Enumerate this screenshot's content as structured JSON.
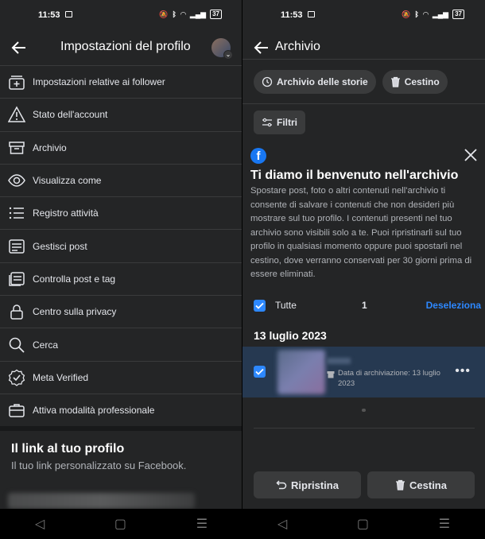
{
  "left": {
    "status": {
      "time": "11:53",
      "battery": "37"
    },
    "header": {
      "title": "Impostazioni del profilo"
    },
    "menu": [
      {
        "label": "Impostazioni relative ai follower",
        "icon": "follower-add-icon"
      },
      {
        "label": "Stato dell'account",
        "icon": "warning-icon"
      },
      {
        "label": "Archivio",
        "icon": "archive-icon"
      },
      {
        "label": "Visualizza come",
        "icon": "eye-icon"
      },
      {
        "label": "Registro attività",
        "icon": "list-icon"
      },
      {
        "label": "Gestisci post",
        "icon": "post-icon"
      },
      {
        "label": "Controlla post e tag",
        "icon": "review-tag-icon"
      },
      {
        "label": "Centro sulla privacy",
        "icon": "lock-icon"
      },
      {
        "label": "Cerca",
        "icon": "search-icon"
      },
      {
        "label": "Meta Verified",
        "icon": "verified-badge-icon"
      },
      {
        "label": "Attiva modalità professionale",
        "icon": "briefcase-icon"
      }
    ],
    "profile_link": {
      "title": "Il link al tuo profilo",
      "subtitle": "Il tuo link personalizzato su Facebook."
    }
  },
  "right": {
    "status": {
      "time": "11:53",
      "battery": "37"
    },
    "header": {
      "title": "Archivio"
    },
    "chips": {
      "stories": "Archivio delle storie",
      "trash": "Cestino"
    },
    "filter_label": "Filtri",
    "welcome": {
      "title": "Ti diamo il benvenuto nell'archivio",
      "body": "Spostare post, foto o altri contenuti nell'archivio ti consente di salvare i contenuti che non desideri più mostrare sul tuo profilo. I contenuti presenti nel tuo archivio sono visibili solo a te. Puoi ripristinarli sul tuo profilo in qualsiasi momento oppure puoi spostarli nel cestino, dove verranno conservati per 30 giorni prima di essere eliminati."
    },
    "select_all": {
      "label": "Tutte",
      "count": "1",
      "deselect": "Deseleziona"
    },
    "date_group": "13 luglio 2023",
    "item": {
      "meta": "Data di archiviazione: 13 luglio 2023"
    },
    "buttons": {
      "restore": "Ripristina",
      "trash": "Cestina"
    }
  },
  "colors": {
    "accent": "#2d88ff",
    "background": "#242526",
    "selected_row": "#263951"
  }
}
